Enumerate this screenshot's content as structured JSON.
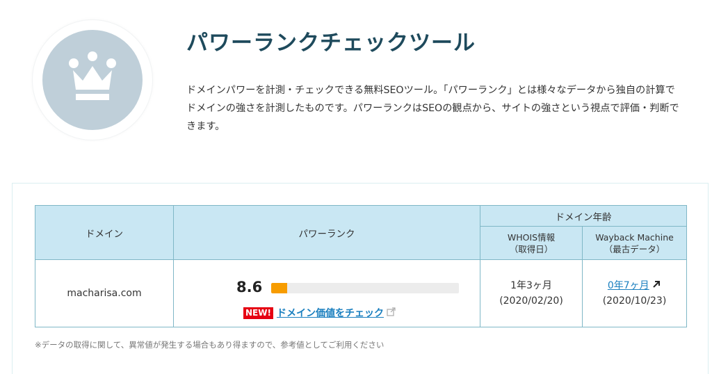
{
  "header": {
    "title": "パワーランクチェックツール",
    "description": "ドメインパワーを計測・チェックできる無料SEOツール。「パワーランク」とは様々なデータから独自の計算でドメインの強さを計測したものです。パワーランクはSEOの観点から、サイトの強さという視点で評価・判断できます。",
    "logo_icon": "crown-icon"
  },
  "table": {
    "headers": {
      "domain": "ドメイン",
      "power_rank": "パワーランク",
      "domain_age": "ドメイン年齢",
      "whois_line1": "WHOIS情報",
      "whois_line2": "（取得日）",
      "wayback_line1": "Wayback Machine",
      "wayback_line2": "（最古データ）"
    },
    "row": {
      "domain": "macharisa.com",
      "power_rank_value": "8.6",
      "power_rank_fraction": 0.086,
      "new_badge": "NEW!",
      "check_link": "ドメイン価値をチェック",
      "whois_age": "1年3ヶ月",
      "whois_date": "(2020/02/20)",
      "wayback_age": "0年7ヶ月",
      "wayback_date": "(2020/10/23)"
    }
  },
  "note": "※データの取得に関して、異常値が発生する場合もあり得ますので、参考値としてご利用ください",
  "colors": {
    "title": "#1e4a5c",
    "header_bg": "#c9e7f3",
    "border": "#7fb7c6",
    "bar_fill": "#f79c00",
    "new_badge": "#e60012",
    "link": "#1a7fbf"
  }
}
